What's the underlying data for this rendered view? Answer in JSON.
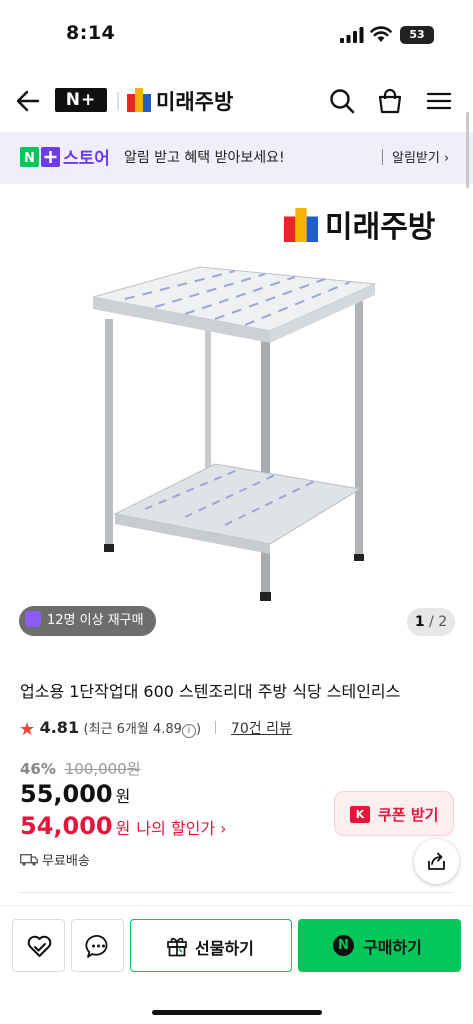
{
  "status_bar": {
    "time": "8:14",
    "battery": "53"
  },
  "header": {
    "store_badge": "N+",
    "brand_name": "미래주방"
  },
  "banner": {
    "store_badge": "N+",
    "store_label": "스토어",
    "message": "알림 받고 혜택 받아보세요!",
    "subscribe_label": "알림받기 ›"
  },
  "product_image": {
    "brand_name": "미래주방",
    "rebuy_badge": "12명 이상 재구매",
    "image_index": "1",
    "image_total": "2"
  },
  "product": {
    "title": "업소용 1단작업대 600 스텐조리대 주방 식당 스테인리스",
    "rating": "4.81",
    "recent_rating": "(최근 6개월 4.89",
    "recent_rating_end": ")",
    "review_count": "70건 리뷰",
    "discount_pct": "46%",
    "original_price": "100,000원",
    "price": "55,000",
    "price_unit": "원",
    "my_price": "54,000",
    "my_price_unit": "원",
    "my_price_label": "나의 할인가 ›",
    "coupon_icon": "K",
    "coupon_label": "쿠폰 받기",
    "shipping": "무료배송"
  },
  "bottom_bar": {
    "gift_label": "선물하기",
    "buy_icon": "N",
    "buy_label": "구매하기"
  },
  "colors": {
    "naver_green": "#03c75a",
    "accent_red": "#e5153c",
    "store_purple": "#6a3de8",
    "banner_bg": "#f1eefb"
  },
  "icons": [
    "back-arrow-icon",
    "search-icon",
    "shopping-bag-icon",
    "menu-icon",
    "info-icon",
    "coupon-icon",
    "truck-icon",
    "share-icon",
    "wishlist-heart-icon",
    "talk-icon",
    "gift-icon",
    "naver-pay-icon"
  ]
}
